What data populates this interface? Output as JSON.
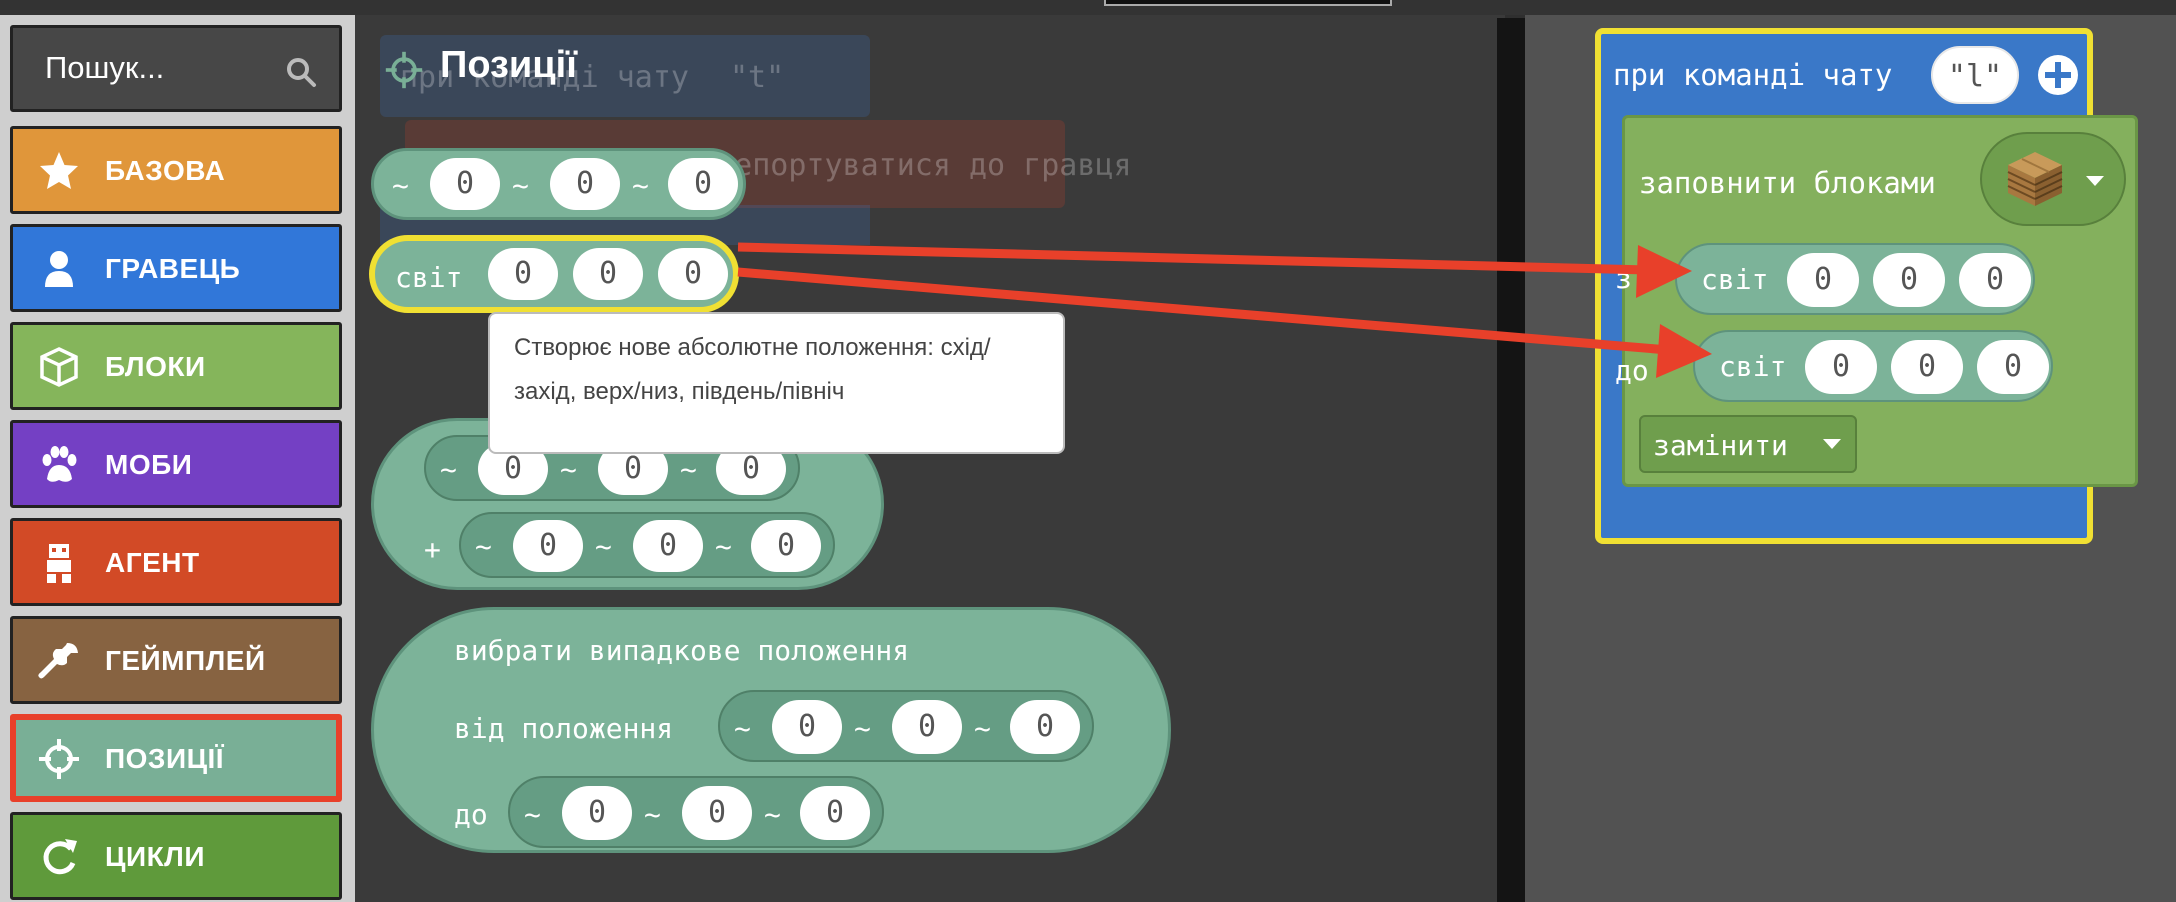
{
  "search": {
    "placeholder": "Пошук..."
  },
  "categories": [
    {
      "label": "БАЗОВА",
      "icon": "star-icon",
      "color": "#e0963a"
    },
    {
      "label": "ГРАВЕЦЬ",
      "icon": "person-icon",
      "color": "#3177d9"
    },
    {
      "label": "БЛОКИ",
      "icon": "cube-icon",
      "color": "#85b55b"
    },
    {
      "label": "МОБИ",
      "icon": "paw-icon",
      "color": "#7440c4"
    },
    {
      "label": "АГЕНТ",
      "icon": "agent-icon",
      "color": "#d24a26"
    },
    {
      "label": "ГЕЙМПЛЕЙ",
      "icon": "wrench-icon",
      "color": "#876341"
    },
    {
      "label": "ПОЗИЦІЇ",
      "icon": "crosshair-icon",
      "color": "#79af96"
    },
    {
      "label": "ЦИКЛИ",
      "icon": "loop-icon",
      "color": "#5f9a3b"
    }
  ],
  "flyout": {
    "title": "Позиції",
    "ghost_chat": "при команді чату",
    "ghost_chat_value": "\"t\"",
    "ghost_teleport": "телепортуватися до гравця",
    "tilde": "~",
    "plus": "+",
    "world_label": "світ",
    "zero": "0",
    "random_label": "вибрати випадкове положення",
    "from_label": "від положення",
    "to_label": "до"
  },
  "tooltip": {
    "text": "Створює нове абсолютне положення: схід/захід, верх/низ, південь/північ"
  },
  "workspace": {
    "chat_label": "при команді чату",
    "chat_value": "\"l\"",
    "fill_label": "заповнити блоками",
    "from_short": "з",
    "to_short": "до",
    "world_label": "світ",
    "zero": "0",
    "replace_label": "замінити"
  },
  "colors": {
    "position_green": "#7cb399",
    "event_blue": "#3a78c8",
    "blocks_green": "#84b05d",
    "highlight_yellow": "#f0e033",
    "arrow_red": "#e8402a"
  }
}
